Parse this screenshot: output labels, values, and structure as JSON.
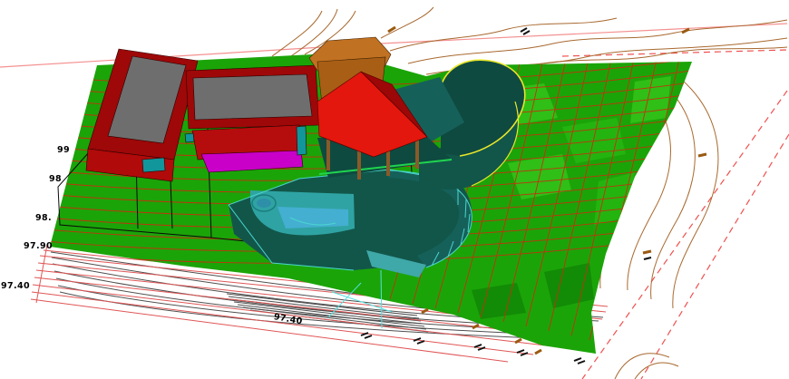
{
  "colors": {
    "background": "#FFFFFF",
    "terrain": "#1BA408",
    "terrain_light": "#2FBF16",
    "terrain_light2": "#24B40F",
    "terrain_dark": "#128B06",
    "terrain_grid": "#C2330F",
    "wall": "#9E0808",
    "wall_front": "#B00A0A",
    "roof_gray": "#6E6E6E",
    "roof_red": "#E3170D",
    "roof_red_shade": "#9C0707",
    "awning_red": "#B50D0D",
    "orange_roof": "#C17122",
    "orange_wall": "#A85E15",
    "magenta": "#C800C8",
    "window_teal": "#11969B",
    "patio_dark": "#12564A",
    "pavilion_floor": "#0E4A40",
    "deck_teal": "#2FA3A3",
    "deck_step": "#3FA8A8",
    "wall_band": "#16605A",
    "pool_blue": "#44AFD0",
    "spa_water": "#2E8FA8",
    "cyan_line": "#49D6CE",
    "cyan_bright": "#55E0E0",
    "yellow_edge": "#E8E62A",
    "post_brown": "#8A5A28",
    "deck_edge_green": "#1FD44F",
    "contour_brown": "#A8692F",
    "contour_gray": "#4F4F4F",
    "survey_red": "#E05555",
    "boundary_pink": "#F49090",
    "dashed_red": "#F05050",
    "marker_brown": "#9A5A10",
    "tick_black": "#111111",
    "black_line": "#0A0A0A",
    "label_color": "#000000"
  },
  "labels": [
    {
      "id": "elev-99",
      "text": "99"
    },
    {
      "id": "elev-98",
      "text": "98"
    },
    {
      "id": "elev-98-dot",
      "text": "98."
    },
    {
      "id": "elev-97-90",
      "text": "97.90"
    },
    {
      "id": "elev-97-40-left",
      "text": "97.40"
    },
    {
      "id": "elev-97-40-bottom",
      "text": "97.40"
    }
  ]
}
